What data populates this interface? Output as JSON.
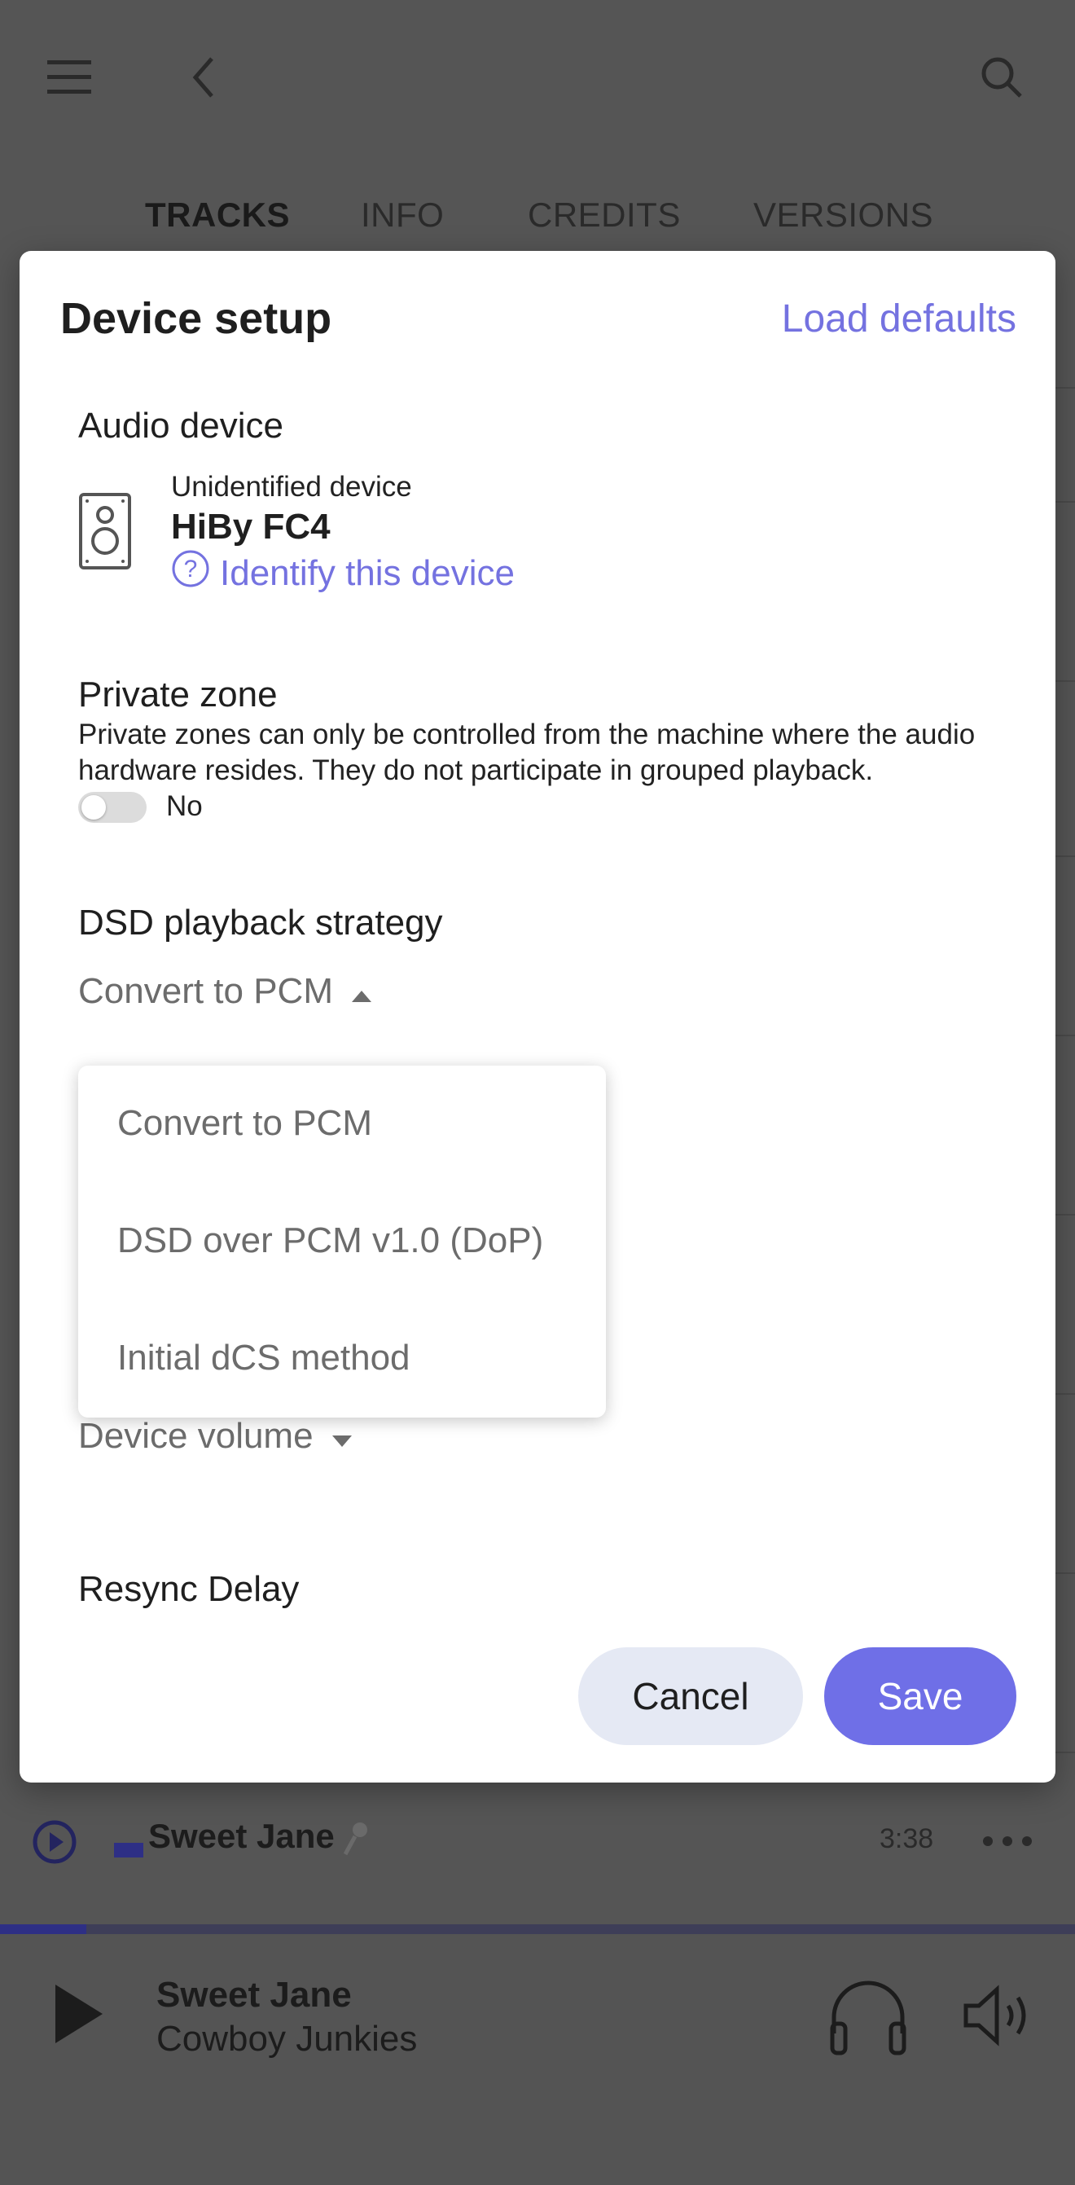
{
  "background": {
    "tabs": [
      "TRACKS",
      "INFO",
      "CREDITS",
      "VERSIONS"
    ],
    "active_tab": "TRACKS",
    "track_row": {
      "title": "Sweet Jane",
      "duration": "3:38"
    },
    "playback_progress": 0.08,
    "now_playing": {
      "title": "Sweet Jane",
      "artist": "Cowboy Junkies"
    }
  },
  "modal": {
    "title": "Device setup",
    "load_defaults": "Load defaults",
    "audio_device": {
      "section_title": "Audio device",
      "status": "Unidentified device",
      "name": "HiBy FC4",
      "identify_link": "Identify this device"
    },
    "private_zone": {
      "section_title": "Private zone",
      "description": "Private zones can only be controlled from the machine where the audio hardware resides. They do not participate in grouped playback.",
      "toggle_value": "No"
    },
    "dsd": {
      "section_title": "DSD playback strategy",
      "selected": "Convert to PCM",
      "options": [
        "Convert to PCM",
        "DSD over PCM v1.0 (DoP)",
        "Initial dCS method"
      ]
    },
    "volume": {
      "selected": "Device volume"
    },
    "resync": {
      "section_title": "Resync Delay"
    },
    "cancel": "Cancel",
    "save": "Save"
  },
  "colors": {
    "accent": "#7472e0",
    "save_bg": "#6f6fe7",
    "cancel_bg": "#e5e9f4",
    "overlay": "#555555"
  }
}
